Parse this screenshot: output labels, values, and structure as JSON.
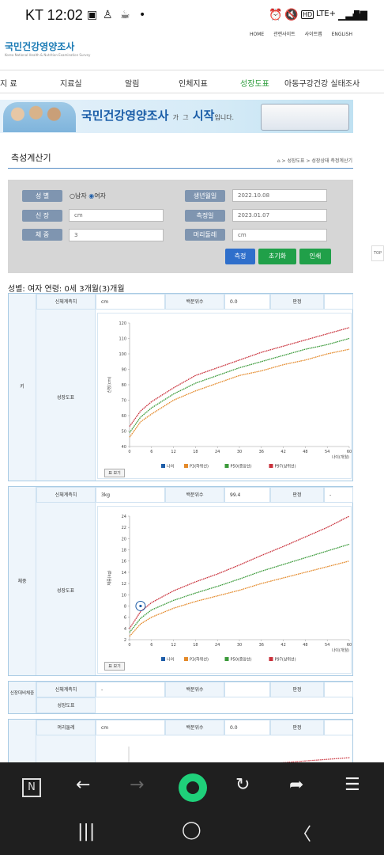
{
  "status_bar": {
    "carrier_time": "KT 12:02",
    "icons_right": "LTE+"
  },
  "top_links": [
    "HOME",
    "관련사이트",
    "사이트맵",
    "ENGLISH"
  ],
  "logo": {
    "title": "국민건강영양조사",
    "subtitle": "Korea National Health & Nutrition Examination Survey"
  },
  "main_menu": [
    "지 료",
    "지료실",
    "알림",
    "인체지표",
    "성장도표",
    "아동구강건강 실태조사"
  ],
  "banner": {
    "title": "국민건강영양조사",
    "tagline_a": "가",
    "tagline_b": "그",
    "tagline_c": "시작",
    "tagline_d": "입니다."
  },
  "page_title": "측성계산기",
  "breadcrumb": "⌂ > 성장도표 > 성장상태 측정계산기",
  "form": {
    "gender_label": "성 별",
    "male": "남자",
    "female": "여자",
    "height_label": "신 장",
    "height_value": "cm",
    "weight_label": "체 중",
    "weight_value": "3",
    "birth_label": "생년월일",
    "birth_value": "2022.10.08",
    "measure_label": "측정일",
    "measure_value": "2023.01.07",
    "head_label": "머리둘레",
    "head_value": "cm",
    "btn_measure": "측정",
    "btn_reset": "초기화",
    "btn_print": "인쇄"
  },
  "summary": "성별: 여자     연령: 0세 3개월(3)개월",
  "edge_tab": "TOP",
  "panels": {
    "height": {
      "section": "키",
      "h1": "신체계측치",
      "v1": "cm",
      "h2": "백분위수",
      "v2": "0.0",
      "h3": "판정",
      "v3": "",
      "chart_label": "성장도표",
      "btn": "표 보기"
    },
    "weight": {
      "section": "체중",
      "h1": "신체계측치",
      "v1": "3kg",
      "h2": "백분위수",
      "v2": "99.4",
      "h3": "판정",
      "v3": "-",
      "chart_label": "성장도표",
      "btn": "표 보기"
    },
    "bmi": {
      "section": "신장대비체중",
      "h1": "신체계측치",
      "v1": "-",
      "h2": "백분위수",
      "v2": "",
      "h3": "판정",
      "v3": "",
      "chart_label": "성장도표"
    },
    "head": {
      "h1": "머리둘레",
      "v1": "cm",
      "h2": "백분위수",
      "v2": "0.0",
      "h3": "판정",
      "v3": ""
    }
  },
  "legend": {
    "me": "나의",
    "p3": "P3(하위선)",
    "p50": "P50(중앙선)",
    "p97": "P97(상위선)"
  },
  "chart_data": [
    {
      "type": "line",
      "title": "",
      "ylabel": "신장(cm)",
      "xlabel": "나이(개월)",
      "x_ticks": [
        0,
        6,
        12,
        18,
        24,
        30,
        36,
        42,
        48,
        54,
        60
      ],
      "y_ticks": [
        40,
        50,
        60,
        70,
        80,
        90,
        100,
        110,
        120
      ],
      "ylim": [
        40,
        120
      ],
      "xlim": [
        0,
        60
      ],
      "series": [
        {
          "name": "P3(하위선)",
          "color": "#e48a2b",
          "x": [
            0,
            3,
            6,
            12,
            18,
            24,
            30,
            36,
            42,
            48,
            54,
            60
          ],
          "y": [
            46,
            56,
            61,
            70,
            76,
            81,
            86,
            89,
            93,
            96,
            100,
            103
          ]
        },
        {
          "name": "P50(중앙선)",
          "color": "#3b9a3a",
          "x": [
            0,
            3,
            6,
            12,
            18,
            24,
            30,
            36,
            42,
            48,
            54,
            60
          ],
          "y": [
            49,
            59,
            65,
            74,
            81,
            86,
            91,
            95,
            99,
            103,
            106,
            110
          ]
        },
        {
          "name": "P97(상위선)",
          "color": "#c9313b",
          "x": [
            0,
            3,
            6,
            12,
            18,
            24,
            30,
            36,
            42,
            48,
            54,
            60
          ],
          "y": [
            53,
            63,
            69,
            78,
            86,
            91,
            96,
            101,
            105,
            109,
            113,
            117
          ]
        }
      ]
    },
    {
      "type": "line",
      "title": "",
      "ylabel": "체중(kg)",
      "xlabel": "나이(개월)",
      "x_ticks": [
        0,
        6,
        12,
        18,
        24,
        30,
        36,
        42,
        48,
        54,
        60
      ],
      "y_ticks": [
        2,
        4,
        6,
        8,
        10,
        12,
        14,
        16,
        18,
        20,
        22,
        24
      ],
      "ylim": [
        2,
        24
      ],
      "xlim": [
        0,
        60
      ],
      "series": [
        {
          "name": "P3(하위선)",
          "color": "#e48a2b",
          "x": [
            0,
            3,
            6,
            12,
            18,
            24,
            30,
            36,
            42,
            48,
            54,
            60
          ],
          "y": [
            2.6,
            4.8,
            6.0,
            7.6,
            8.8,
            9.8,
            10.8,
            12.0,
            13.0,
            14.0,
            15.0,
            16.0
          ]
        },
        {
          "name": "P50(중앙선)",
          "color": "#3b9a3a",
          "x": [
            0,
            3,
            6,
            12,
            18,
            24,
            30,
            36,
            42,
            48,
            54,
            60
          ],
          "y": [
            3.3,
            5.8,
            7.3,
            9.0,
            10.3,
            11.5,
            12.8,
            14.2,
            15.4,
            16.6,
            17.8,
            19.0
          ]
        },
        {
          "name": "P97(상위선)",
          "color": "#c9313b",
          "x": [
            0,
            3,
            6,
            12,
            18,
            24,
            30,
            36,
            42,
            48,
            54,
            60
          ],
          "y": [
            4.0,
            7.0,
            8.6,
            10.7,
            12.3,
            13.7,
            15.3,
            17.0,
            18.6,
            20.3,
            22.0,
            24.0
          ]
        },
        {
          "name": "나의",
          "color": "#1e5da8",
          "x": [
            3
          ],
          "y": [
            8
          ]
        }
      ]
    }
  ]
}
